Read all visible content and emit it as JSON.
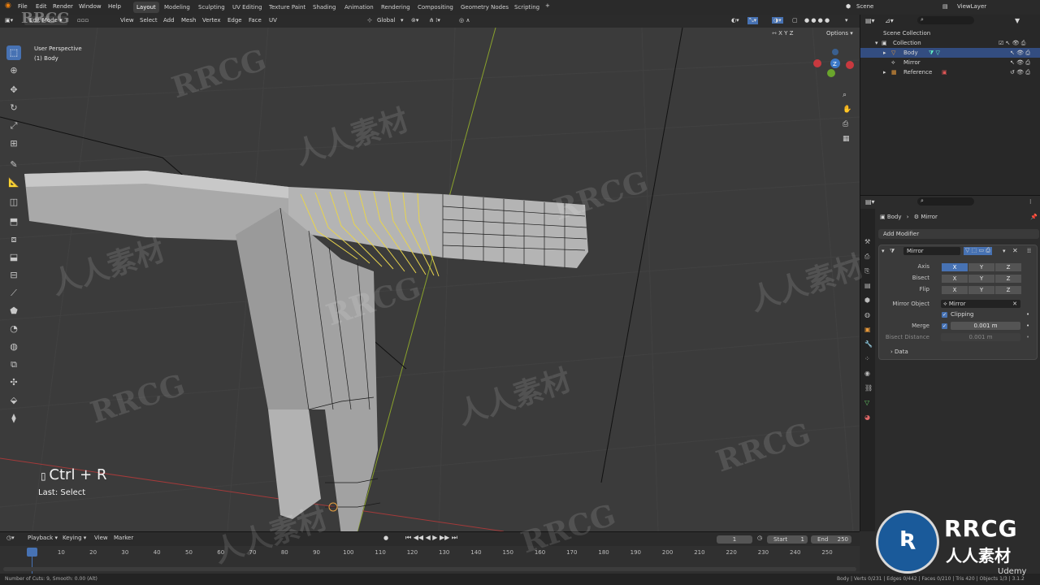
{
  "topbar": {
    "menus": [
      "File",
      "Edit",
      "Render",
      "Window",
      "Help"
    ],
    "workspaces": [
      "Layout",
      "Modeling",
      "Sculpting",
      "UV Editing",
      "Texture Paint",
      "Shading",
      "Animation",
      "Rendering",
      "Compositing",
      "Geometry Nodes",
      "Scripting"
    ],
    "active_workspace": "Layout",
    "scene": "Scene",
    "view_layer": "ViewLayer"
  },
  "header": {
    "mode": "Edit Mode",
    "menus": [
      "View",
      "Select",
      "Add",
      "Mesh",
      "Vertex",
      "Edge",
      "Face",
      "UV"
    ],
    "orientation": "Global",
    "options": "Options",
    "axes": [
      "X",
      "Y",
      "Z"
    ]
  },
  "viewport": {
    "perspective": "User Perspective",
    "object": "(1) Body",
    "shortcut": "Ctrl + R",
    "last_op": "Last: Select"
  },
  "outliner": {
    "root": "Scene Collection",
    "collection": "Collection",
    "items": [
      "Body",
      "Mirror",
      "Reference"
    ]
  },
  "properties": {
    "breadcrumb_object": "Body",
    "breadcrumb_modifier": "Mirror",
    "add_modifier": "Add Modifier",
    "modifier_name": "Mirror",
    "axis_label": "Axis",
    "bisect_label": "Bisect",
    "flip_label": "Flip",
    "axes": [
      "X",
      "Y",
      "Z"
    ],
    "mirror_object_label": "Mirror Object",
    "mirror_object_value": "Mirror",
    "clipping_label": "Clipping",
    "merge_label": "Merge",
    "merge_value": "0.001 m",
    "bisect_distance_label": "Bisect Distance",
    "bisect_distance_value": "0.001 m",
    "data_label": "Data"
  },
  "timeline": {
    "menus": [
      "Playback",
      "Keying",
      "View",
      "Marker"
    ],
    "current_frame": "1",
    "start_label": "Start",
    "start_value": "1",
    "end_label": "End",
    "end_value": "250",
    "ticks": [
      "1",
      "10",
      "20",
      "30",
      "40",
      "50",
      "60",
      "70",
      "80",
      "90",
      "100",
      "110",
      "120",
      "130",
      "140",
      "150",
      "160",
      "170",
      "180",
      "190",
      "200",
      "210",
      "220",
      "230",
      "240",
      "250"
    ]
  },
  "status": {
    "left": "Number of Cuts: 9, Smooth: 0.00 (Alt)",
    "right": "Body | Verts 0/231 | Edges 0/442 | Faces 0/210 | Tris 420 | Objects 1/3 | 3.1.2"
  },
  "watermarks": {
    "rrcg": "RRCG",
    "cn": "人人素材",
    "udemy": "Udemy"
  },
  "colors": {
    "accent": "#4772b3",
    "selection_edges": "#e8d44d",
    "viewport_bg": "#3b3b3b",
    "panel_bg": "#2c2c2c"
  }
}
